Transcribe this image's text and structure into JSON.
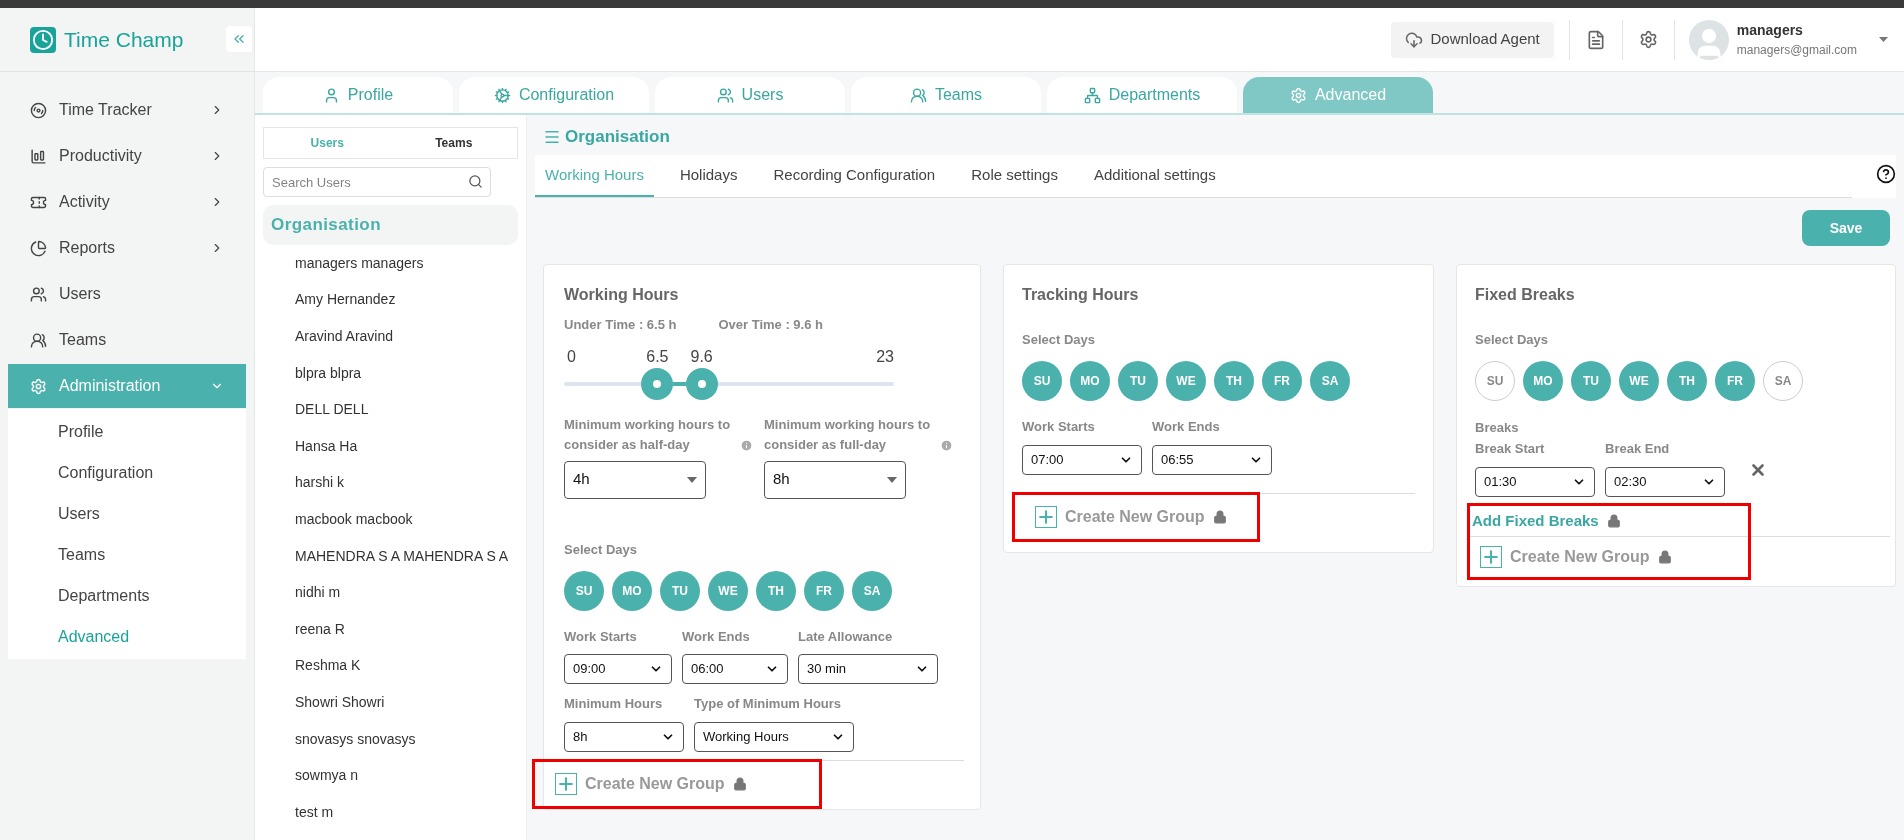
{
  "app": {
    "name": "Time Champ"
  },
  "header": {
    "download_button": "Download Agent",
    "user": {
      "name": "managers",
      "email": "managers@gmail.com"
    }
  },
  "sidebar": {
    "items": [
      {
        "label": "Time Tracker",
        "has_chevron": true,
        "expanded": false,
        "selected": false
      },
      {
        "label": "Productivity",
        "has_chevron": true,
        "expanded": false,
        "selected": false
      },
      {
        "label": "Activity",
        "has_chevron": true,
        "expanded": false,
        "selected": false
      },
      {
        "label": "Reports",
        "has_chevron": true,
        "expanded": false,
        "selected": false
      },
      {
        "label": "Users",
        "has_chevron": false,
        "selected": false
      },
      {
        "label": "Teams",
        "has_chevron": false,
        "selected": false
      },
      {
        "label": "Administration",
        "has_chevron": true,
        "expanded": true,
        "selected": true,
        "children": [
          {
            "label": "Profile",
            "selected": false
          },
          {
            "label": "Configuration",
            "selected": false
          },
          {
            "label": "Users",
            "selected": false
          },
          {
            "label": "Teams",
            "selected": false
          },
          {
            "label": "Departments",
            "selected": false
          },
          {
            "label": "Advanced",
            "selected": true
          }
        ]
      }
    ]
  },
  "top_tabs": [
    {
      "label": "Profile",
      "selected": false
    },
    {
      "label": "Configuration",
      "selected": false
    },
    {
      "label": "Users",
      "selected": false
    },
    {
      "label": "Teams",
      "selected": false
    },
    {
      "label": "Departments",
      "selected": false
    },
    {
      "label": "Advanced",
      "selected": true
    }
  ],
  "user_panel": {
    "tabs": [
      {
        "label": "Users",
        "selected": true
      },
      {
        "label": "Teams",
        "selected": false
      }
    ],
    "search": {
      "placeholder": "Search Users"
    },
    "group": "Organisation",
    "users": [
      "managers managers",
      "Amy Hernandez",
      "Aravind Aravind",
      "blpra blpra",
      "DELL DELL",
      "Hansa Ha",
      "harshi k",
      "macbook macbook",
      "MAHENDRA S A MAHENDRA S A",
      "nidhi m",
      "reena R",
      "Reshma K",
      "Showri Showri",
      "snovasys snovasys",
      "sowmya n",
      "test m"
    ]
  },
  "page": {
    "title": "Organisation",
    "save_button": "Save",
    "tabs": [
      {
        "label": "Working Hours",
        "selected": true
      },
      {
        "label": "Holidays",
        "selected": false
      },
      {
        "label": "Recording Configuration",
        "selected": false
      },
      {
        "label": "Role settings",
        "selected": false
      },
      {
        "label": "Additional settings",
        "selected": false
      }
    ]
  },
  "working_hours": {
    "title": "Working Hours",
    "under_time": "Under Time : 6.5 h",
    "over_time": "Over Time : 9.6 h",
    "slider": {
      "min_label": "0",
      "max_label": "23",
      "thumbs": [
        {
          "label": "6.5",
          "level": 0.283
        },
        {
          "label": "9.6",
          "level": 0.417
        }
      ]
    },
    "half_day": {
      "label": "Minimum working hours to consider as half-day",
      "value": "4h"
    },
    "full_day": {
      "label": "Minimum working hours to consider as full-day",
      "value": "8h"
    },
    "days_label": "Select Days",
    "days": [
      {
        "label": "SU",
        "selected": true
      },
      {
        "label": "MO",
        "selected": true
      },
      {
        "label": "TU",
        "selected": true
      },
      {
        "label": "WE",
        "selected": true
      },
      {
        "label": "TH",
        "selected": true
      },
      {
        "label": "FR",
        "selected": true
      },
      {
        "label": "SA",
        "selected": true
      }
    ],
    "fields": [
      {
        "label": "Work Starts",
        "value": "09:00"
      },
      {
        "label": "Work Ends",
        "value": "06:00"
      },
      {
        "label": "Late Allowance",
        "value": "30 min"
      }
    ],
    "fields2": [
      {
        "label": "Minimum Hours",
        "value": "8h"
      },
      {
        "label": "Type of Minimum Hours",
        "value": "Working Hours"
      }
    ],
    "create_group": {
      "label": "Create New Group",
      "locked": true,
      "highlighted": true
    }
  },
  "tracking_hours": {
    "title": "Tracking Hours",
    "days_label": "Select Days",
    "days": [
      {
        "label": "SU",
        "selected": true
      },
      {
        "label": "MO",
        "selected": true
      },
      {
        "label": "TU",
        "selected": true
      },
      {
        "label": "WE",
        "selected": true
      },
      {
        "label": "TH",
        "selected": true
      },
      {
        "label": "FR",
        "selected": true
      },
      {
        "label": "SA",
        "selected": true
      }
    ],
    "fields": [
      {
        "label": "Work Starts",
        "value": "07:00"
      },
      {
        "label": "Work Ends",
        "value": "06:55"
      }
    ],
    "create_group": {
      "label": "Create New Group",
      "locked": true,
      "highlighted": true
    }
  },
  "fixed_breaks": {
    "title": "Fixed Breaks",
    "days_label": "Select Days",
    "days": [
      {
        "label": "SU",
        "selected": false
      },
      {
        "label": "MO",
        "selected": true
      },
      {
        "label": "TU",
        "selected": true
      },
      {
        "label": "WE",
        "selected": true
      },
      {
        "label": "TH",
        "selected": true
      },
      {
        "label": "FR",
        "selected": true
      },
      {
        "label": "SA",
        "selected": false
      }
    ],
    "breaks_label": "Breaks",
    "fields": [
      {
        "label": "Break Start",
        "value": "01:30"
      },
      {
        "label": "Break End",
        "value": "02:30"
      }
    ],
    "add_breaks": {
      "label": "Add Fixed Breaks",
      "locked": true
    },
    "create_group": {
      "label": "Create New Group",
      "locked": true,
      "highlighted": true
    }
  }
}
